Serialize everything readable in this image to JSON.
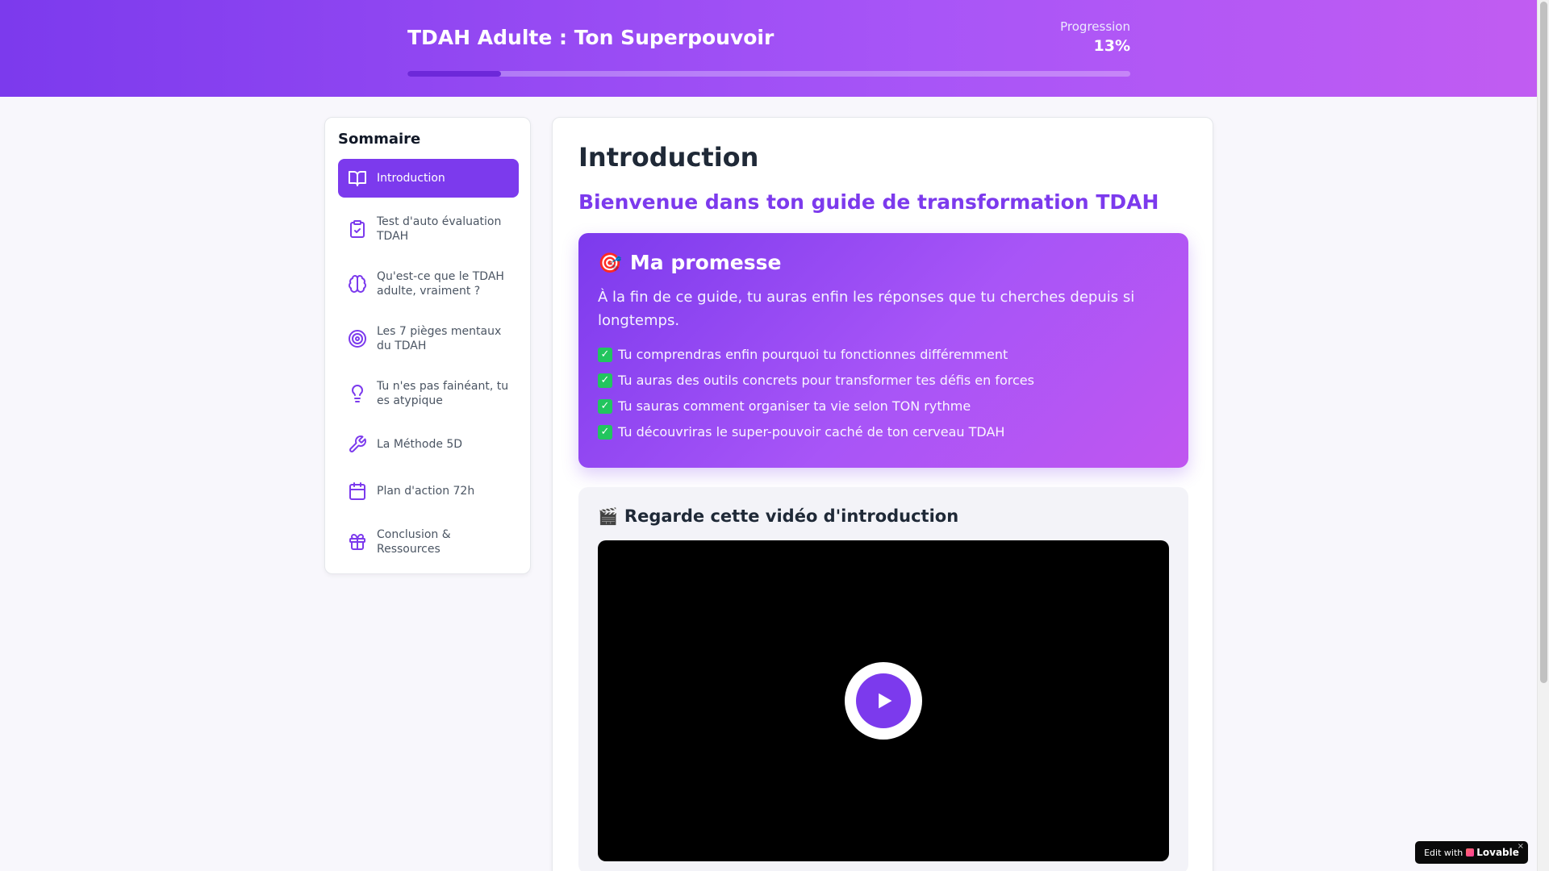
{
  "header": {
    "title": "TDAH Adulte : Ton Superpouvoir",
    "progress_label": "Progression",
    "progress_value": "13%",
    "progress_fraction": 0.13,
    "accent": "#7c3aed"
  },
  "sidebar": {
    "title": "Sommaire",
    "items": [
      {
        "label": "Introduction",
        "icon": "book-open-icon",
        "active": true
      },
      {
        "label": "Test d'auto évaluation TDAH",
        "icon": "clipboard-check-icon",
        "active": false
      },
      {
        "label": "Qu'est-ce que le TDAH adulte, vraiment ?",
        "icon": "brain-icon",
        "active": false
      },
      {
        "label": "Les 7 pièges mentaux du TDAH",
        "icon": "target-icon",
        "active": false
      },
      {
        "label": "Tu n'es pas fainéant, tu es atypique",
        "icon": "lightbulb-icon",
        "active": false
      },
      {
        "label": "La Méthode 5D",
        "icon": "wrench-icon",
        "active": false
      },
      {
        "label": "Plan d'action 72h",
        "icon": "calendar-icon",
        "active": false
      },
      {
        "label": "Conclusion & Ressources",
        "icon": "gift-icon",
        "active": false
      }
    ]
  },
  "main": {
    "title": "Introduction",
    "subtitle": "Bienvenue dans ton guide de transformation TDAH",
    "promise": {
      "emoji": "🎯",
      "title": "Ma promesse",
      "text": "À la fin de ce guide, tu auras enfin les réponses que tu cherches depuis si longtemps.",
      "check_glyph": "✓",
      "items": [
        "Tu comprendras enfin pourquoi tu fonctionnes différemment",
        "Tu auras des outils concrets pour transformer tes défis en forces",
        "Tu sauras comment organiser ta vie selon TON rythme",
        "Tu découvriras le super-pouvoir caché de ton cerveau TDAH"
      ]
    },
    "video": {
      "emoji": "🎬",
      "title": "Regarde cette vidéo d'introduction"
    }
  },
  "badge": {
    "prefix": "Edit with",
    "brand": "Lovable",
    "close": "×"
  }
}
